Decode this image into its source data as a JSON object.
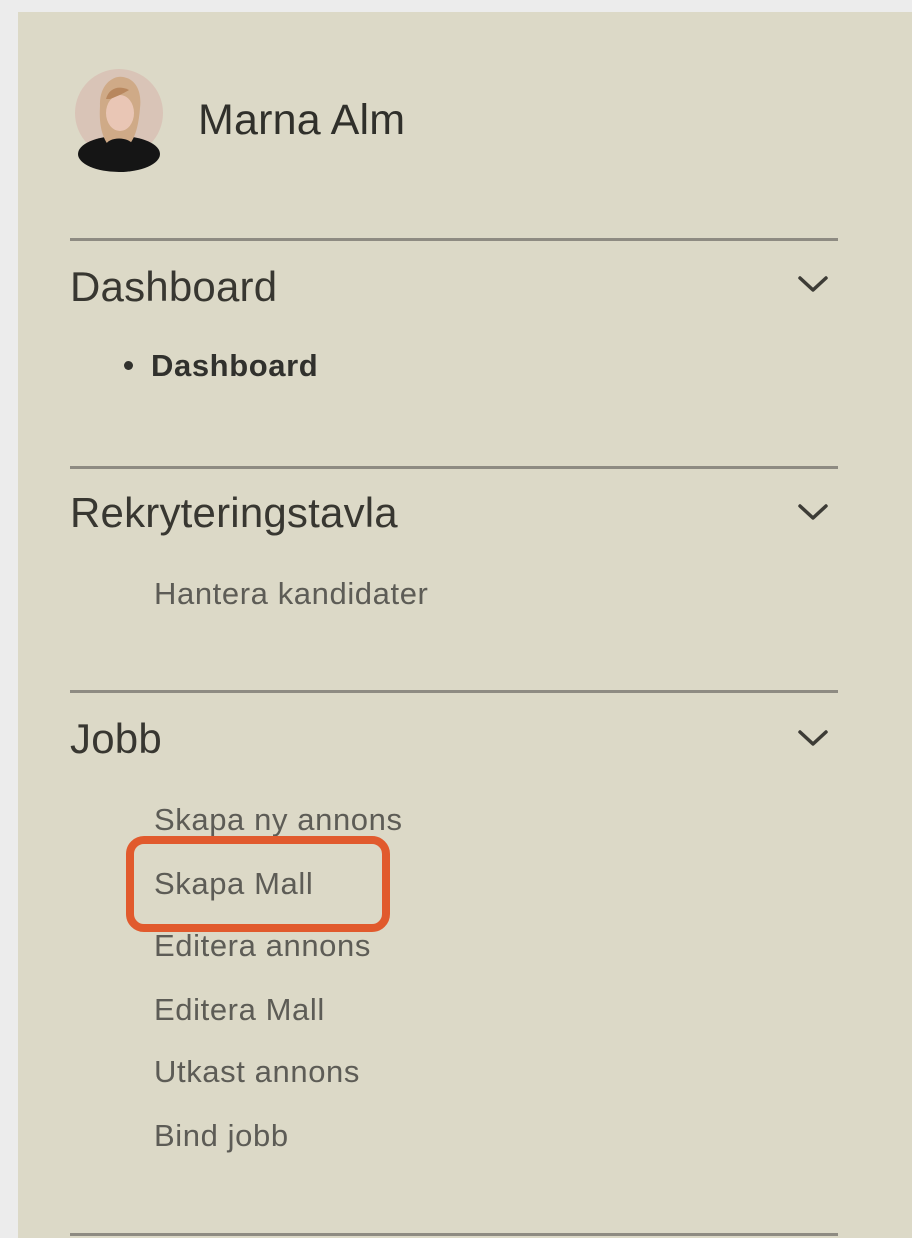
{
  "user": {
    "name": "Marna Alm"
  },
  "sections": [
    {
      "title": "Dashboard",
      "items": [
        {
          "label": "Dashboard",
          "active": true
        }
      ]
    },
    {
      "title": "Rekryteringstavla",
      "items": [
        {
          "label": "Hantera kandidater",
          "active": false
        }
      ]
    },
    {
      "title": "Jobb",
      "items": [
        {
          "label": "Skapa ny annons",
          "active": false
        },
        {
          "label": "Skapa Mall",
          "active": false,
          "highlighted": true
        },
        {
          "label": "Editera annons",
          "active": false
        },
        {
          "label": "Editera Mall",
          "active": false
        },
        {
          "label": "Utkast annons",
          "active": false
        },
        {
          "label": "Bind jobb",
          "active": false
        }
      ]
    }
  ],
  "colors": {
    "panel_background": "#dcd9c7",
    "page_background": "#ececec",
    "highlight_outline": "#e15a2d",
    "text_primary": "#383731",
    "text_secondary": "#5d5c56"
  },
  "icons": {
    "avatar": "avatar",
    "chevron": "chevron-down-icon",
    "bullet": "bullet-icon"
  }
}
